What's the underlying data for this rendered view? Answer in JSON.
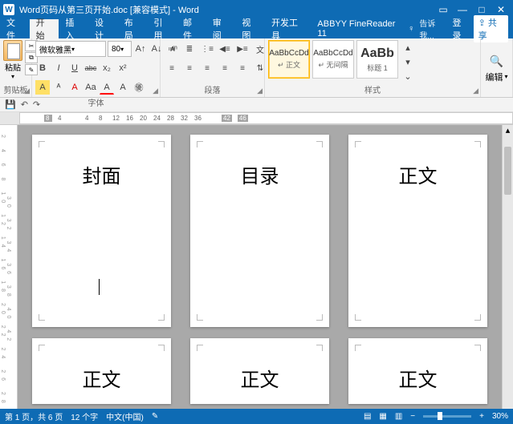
{
  "titlebar": {
    "title": "Word页码从第三页开始.doc [兼容模式] - Word"
  },
  "menubar": {
    "items": [
      "文件",
      "开始",
      "插入",
      "设计",
      "布局",
      "引用",
      "邮件",
      "审阅",
      "视图",
      "开发工具",
      "ABBYY FineReader 11"
    ],
    "active_index": 1,
    "tellme": "告诉我...",
    "login": "登录",
    "share": "共享"
  },
  "ribbon": {
    "clipboard": {
      "paste": "粘贴",
      "label": "剪贴板"
    },
    "font": {
      "family": "微软雅黑",
      "size": "80",
      "label": "字体",
      "buttons_row2": [
        "B",
        "I",
        "U",
        "abc",
        "x₂",
        "x²"
      ],
      "buttons_row3": [
        "A",
        "ᴬ",
        "A",
        "Aa",
        "A"
      ]
    },
    "paragraph": {
      "label": "段落"
    },
    "styles": {
      "label": "样式",
      "items": [
        {
          "preview": "AaBbCcDd",
          "name": "↵ 正文",
          "selected": true
        },
        {
          "preview": "AaBbCcDd",
          "name": "↵ 无间隔",
          "selected": false
        },
        {
          "preview": "AaBb",
          "name": "标题 1",
          "selected": false,
          "big": true
        }
      ]
    },
    "edit": {
      "label": "编辑"
    }
  },
  "ruler": {
    "marks": [
      "8",
      "4",
      "",
      "4",
      "8",
      "12",
      "16",
      "20",
      "24",
      "28",
      "32",
      "36",
      "",
      "42",
      "46"
    ]
  },
  "pages": {
    "row1": [
      "封面",
      "目录",
      "正文"
    ],
    "row2": [
      "正文",
      "正文",
      "正文"
    ]
  },
  "statusbar": {
    "page": "第 1 页，共 6 页",
    "words": "12 个字",
    "lang": "中文(中国)",
    "zoom": "30%"
  }
}
